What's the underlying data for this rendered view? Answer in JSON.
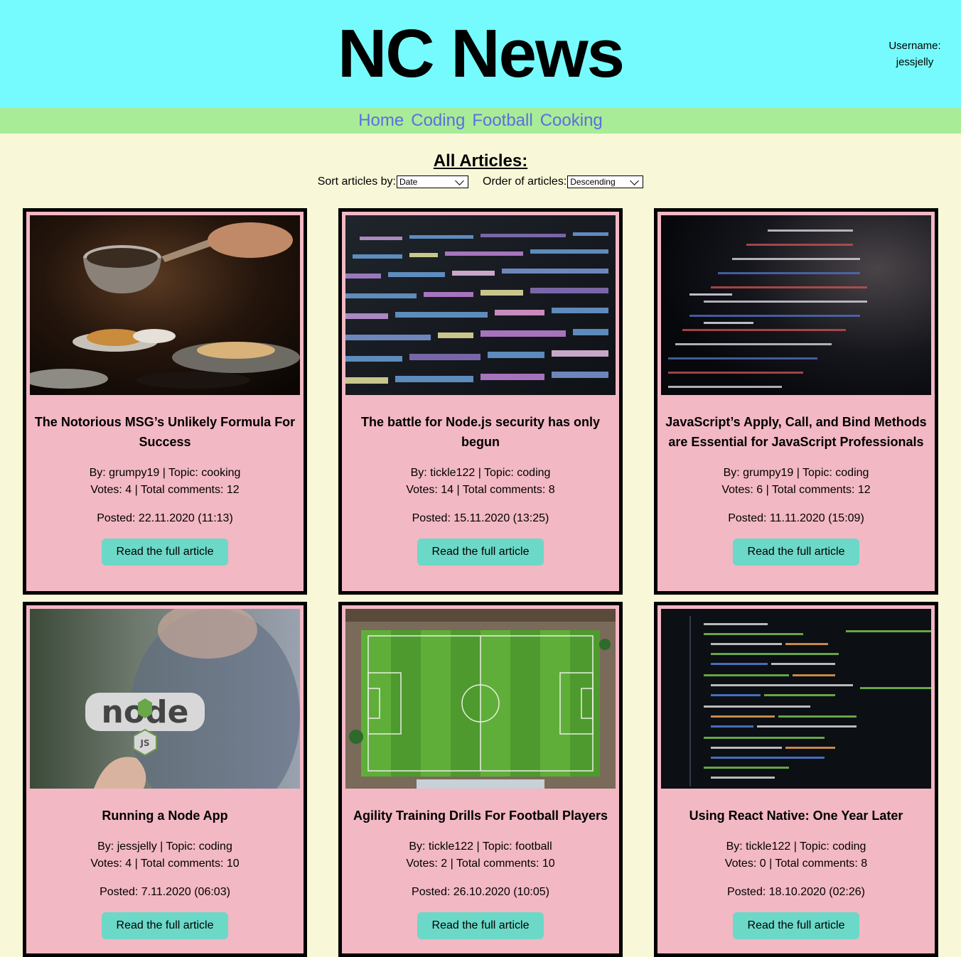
{
  "header": {
    "title": "NC News",
    "username_label": "Username:",
    "username": "jessjelly"
  },
  "nav": {
    "items": [
      "Home",
      "Coding",
      "Football",
      "Cooking"
    ]
  },
  "main": {
    "heading": "All Articles:",
    "sort_label": "Sort articles by:",
    "sort_value": "Date",
    "order_label": "Order of articles:",
    "order_value": "Descending",
    "read_label": "Read the full article"
  },
  "articles": [
    {
      "title": "The Notorious MSG’s Unlikely Formula For Success",
      "by": "By: grumpy19 | Topic: cooking",
      "stats": "Votes: 4 | Total comments: 12",
      "posted": "Posted: 22.11.2020 (11:13)",
      "image": "cooking-photo"
    },
    {
      "title": "The battle for Node.js security has only begun",
      "by": "By: tickle122 | Topic: coding",
      "stats": "Votes: 14 | Total comments: 8",
      "posted": "Posted: 15.11.2020 (13:25)",
      "image": "code-screen-photo"
    },
    {
      "title": "JavaScript’s Apply, Call, and Bind Methods are Essential for JavaScript Professionals",
      "by": "By: grumpy19 | Topic: coding",
      "stats": "Votes: 6 | Total comments: 12",
      "posted": "Posted: 11.11.2020 (15:09)",
      "image": "code-dark-photo"
    },
    {
      "title": "Running a Node App",
      "by": "By: jessjelly | Topic: coding",
      "stats": "Votes: 4 | Total comments: 10",
      "posted": "Posted: 7.11.2020 (06:03)",
      "image": "node-sticker-photo"
    },
    {
      "title": "Agility Training Drills For Football Players",
      "by": "By: tickle122 | Topic: football",
      "stats": "Votes: 2 | Total comments: 10",
      "posted": "Posted: 26.10.2020 (10:05)",
      "image": "football-pitch-photo"
    },
    {
      "title": "Using React Native: One Year Later",
      "by": "By: tickle122 | Topic: coding",
      "stats": "Votes: 0 | Total comments: 8",
      "posted": "Posted: 18.10.2020 (02:26)",
      "image": "code-editor-photo"
    }
  ],
  "colors": {
    "header_bg": "#75fbfd",
    "nav_bg": "#a8ec98",
    "nav_link": "#5b6fe0",
    "page_bg": "#f8f8d8",
    "card_bg": "#f2b8c3",
    "button_bg": "#6cd8c8"
  }
}
